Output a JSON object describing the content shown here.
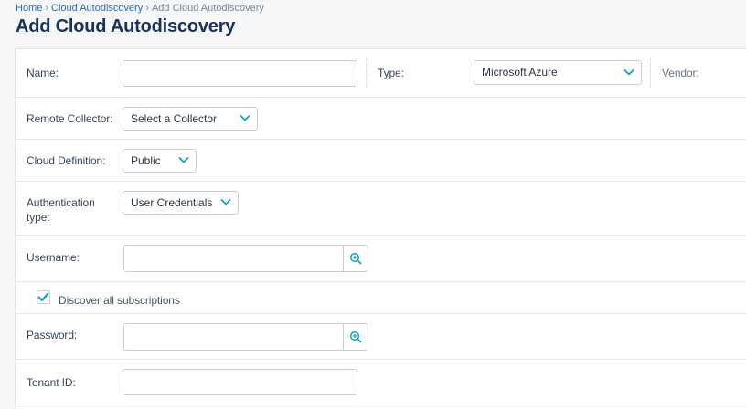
{
  "breadcrumb": {
    "home": "Home",
    "parent": "Cloud Autodiscovery",
    "current": "Add Cloud Autodiscovery",
    "separator": "›"
  },
  "page": {
    "title": "Add Cloud Autodiscovery"
  },
  "form": {
    "name": {
      "label": "Name:",
      "value": ""
    },
    "type": {
      "label": "Type:",
      "selected": "Microsoft Azure"
    },
    "vendor": {
      "label": "Vendor:"
    },
    "remote_collector": {
      "label": "Remote Collector:",
      "selected": "Select a Collector"
    },
    "cloud_definition": {
      "label": "Cloud Definition:",
      "selected": "Public"
    },
    "auth_type": {
      "label_line1": "Authentication",
      "label_line2": "type:",
      "selected": "User Credentials"
    },
    "username": {
      "label": "Username:",
      "value": ""
    },
    "discover_all": {
      "label": "Discover all subscriptions",
      "checked": true
    },
    "password": {
      "label": "Password:",
      "value": ""
    },
    "tenant_id": {
      "label": "Tenant ID:",
      "value": ""
    }
  },
  "icons": {
    "chevron": "chevron-down-icon",
    "lookup": "zoom-in-icon",
    "check": "check-icon"
  },
  "colors": {
    "accent": "#17a2b8",
    "title": "#1d3354",
    "link": "#2f6ab3"
  }
}
